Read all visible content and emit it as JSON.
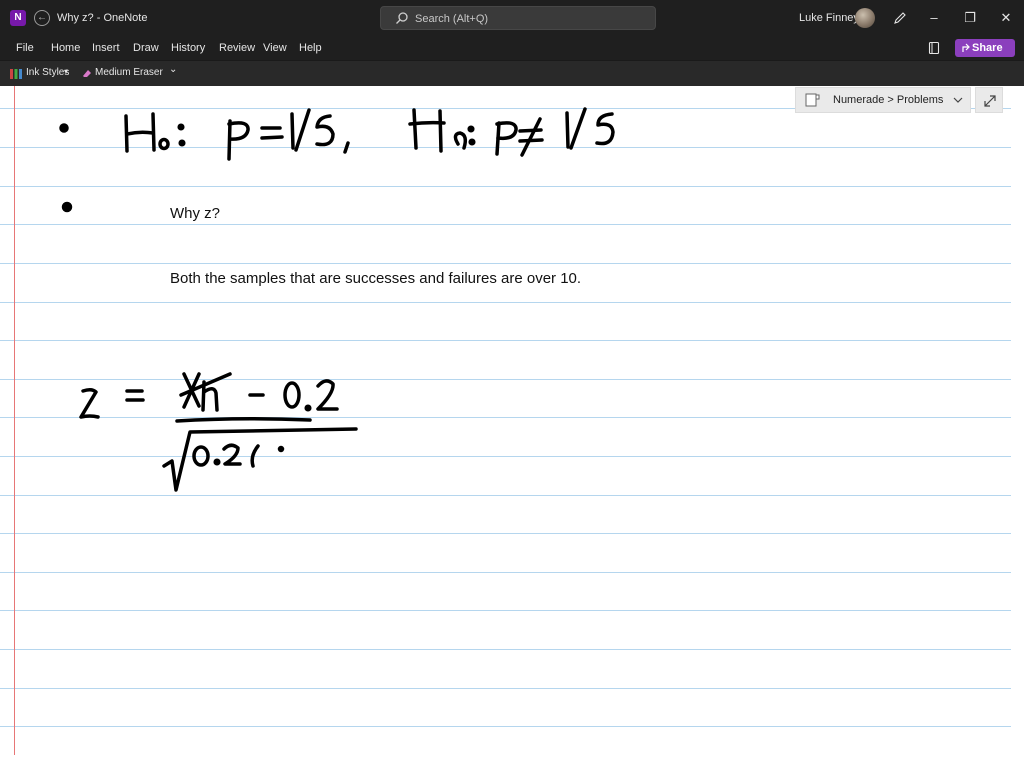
{
  "titlebar": {
    "app_icon_letter": "N",
    "window_title": "Why z?  -  OneNote",
    "search_placeholder": "Search (Alt+Q)",
    "user_name": "Luke Finney",
    "window_controls": [
      "minimize-icon",
      "restore-icon",
      "close-icon"
    ]
  },
  "menu": {
    "items": [
      "File",
      "Home",
      "Insert",
      "Draw",
      "History",
      "Review",
      "View",
      "Help"
    ],
    "share_label": "Share"
  },
  "ribbon": {
    "ink_styles": "Ink Styles",
    "eraser": "Medium Eraser",
    "more": "⌄"
  },
  "breadcrumb": {
    "text": "Numerade > Problems"
  },
  "note": {
    "line1": "Why z?",
    "line2": "Both the samples that are successes and failures are over 10."
  },
  "colors": {
    "titlebar_bg": "#1f1f1f",
    "accent": "#8b3fbd",
    "rule_line": "#b5d6ee",
    "margin_line": "#e77676",
    "ink": "#000000"
  }
}
